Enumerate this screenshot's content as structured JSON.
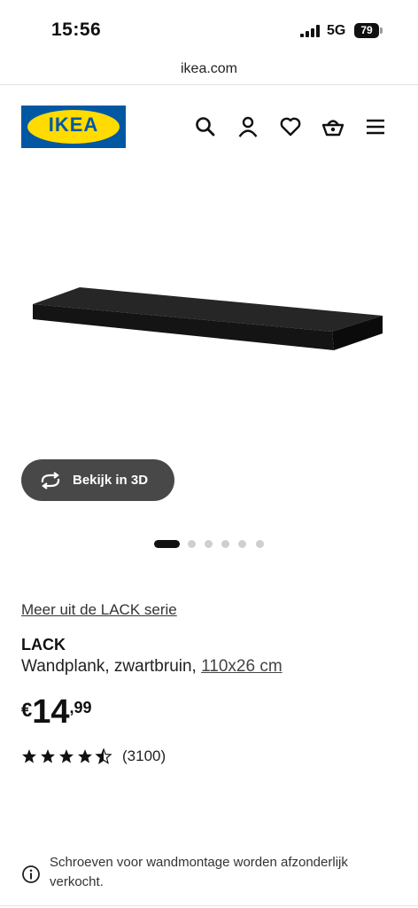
{
  "status_bar": {
    "time": "15:56",
    "network": "5G",
    "battery": "79"
  },
  "browser": {
    "url": "ikea.com"
  },
  "header": {
    "logo_text": "IKEA",
    "icons": [
      "search-icon",
      "account-icon",
      "heart-icon",
      "basket-icon",
      "menu-icon"
    ],
    "brand_blue": "#0058a3",
    "brand_yellow": "#ffdb00"
  },
  "gallery": {
    "view_3d_label": "Bekijk in 3D",
    "image_count": 6,
    "active_index": 0
  },
  "product": {
    "series_link": "Meer uit de LACK serie",
    "name": "LACK",
    "description": "Wandplank, zwartbruin, ",
    "size": "110x26 cm",
    "price_currency": "€",
    "price_integer": "14",
    "price_decimal": ",99",
    "rating": 4.5,
    "review_count": "(3100)"
  },
  "notice": {
    "text": "Schroeven voor wandmontage worden afzonderlijk verkocht."
  }
}
